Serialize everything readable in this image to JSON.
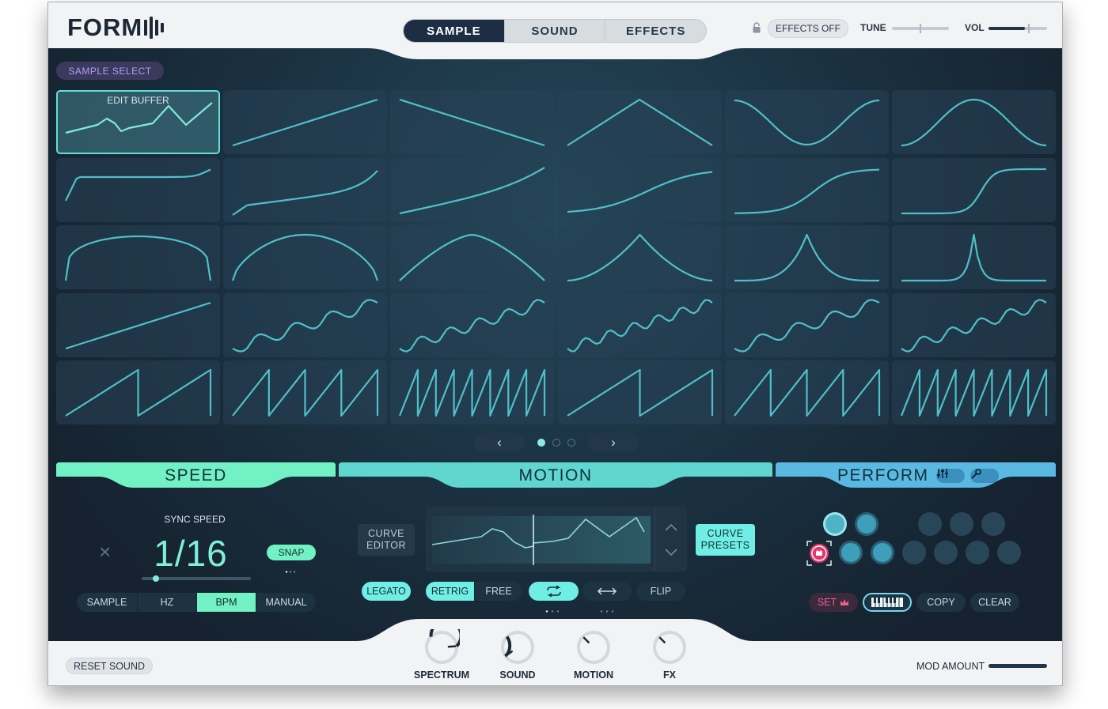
{
  "header": {
    "logo": "FORM",
    "tabs": [
      {
        "label": "SAMPLE",
        "active": true
      },
      {
        "label": "SOUND",
        "active": false
      },
      {
        "label": "EFFECTS",
        "active": false
      }
    ],
    "effects_off_label": "EFFECTS OFF",
    "tune_label": "TUNE",
    "vol_label": "VOL",
    "tune_value": 0.5,
    "vol_value": 0.62
  },
  "sample": {
    "select_label": "SAMPLE SELECT",
    "edit_buffer_label": "EDIT BUFFER",
    "page": 1,
    "pages": 3
  },
  "sections": {
    "speed": "SPEED",
    "motion": "MOTION",
    "perform": "PERFORM"
  },
  "speed": {
    "sync_label": "SYNC SPEED",
    "value": "1/16",
    "snap_label": "SNAP",
    "modes": [
      "SAMPLE",
      "HZ",
      "BPM",
      "MANUAL"
    ],
    "active_mode": "BPM"
  },
  "motion": {
    "curve_editor": [
      "CURVE",
      "EDITOR"
    ],
    "curve_presets": [
      "CURVE",
      "PRESETS"
    ],
    "legato": "LEGATO",
    "retrig": "RETRIG",
    "free": "FREE",
    "flip": "FLIP"
  },
  "perform": {
    "set_label": "SET",
    "copy_label": "COPY",
    "clear_label": "CLEAR"
  },
  "footer": {
    "reset_label": "RESET SOUND",
    "knobs": [
      {
        "label": "SPECTRUM",
        "value": 0.85
      },
      {
        "label": "SOUND",
        "value": 0.3
      },
      {
        "label": "MOTION",
        "value": 0.0
      },
      {
        "label": "FX",
        "value": 0.0
      }
    ],
    "mod_amount_label": "MOD AMOUNT",
    "mod_amount": 1.0
  },
  "colors": {
    "accent_speed": "#72f2c4",
    "accent_motion": "#5fd6cf",
    "accent_perform": "#5ab9e3",
    "wave": "#4fc0c8"
  }
}
